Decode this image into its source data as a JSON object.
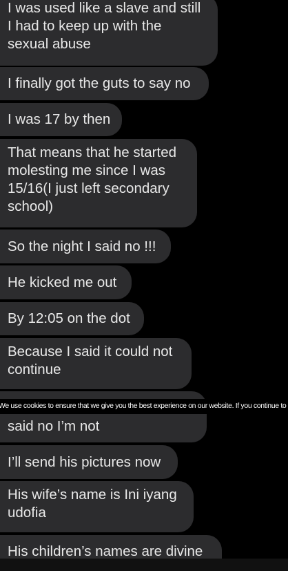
{
  "messages": [
    {
      "text": "I was used like a slave and still\nI had to keep up with the\nsexual abuse"
    },
    {
      "text": "I finally got the guts to say no"
    },
    {
      "text": "I was 17 by then"
    },
    {
      "text": "That means that he started\nmolesting me since I was\n15/16(I just left secondary\nschool)"
    },
    {
      "text": "So the night I said no !!!"
    },
    {
      "text": "He kicked me out"
    },
    {
      "text": "By 12:05 on the dot"
    },
    {
      "text": "Because I said it could not\ncontinue"
    },
    {
      "text": "said no I’m not"
    },
    {
      "text": "I’ll send his pictures now"
    },
    {
      "text": "His wife’s name is Ini iyang\nudofia"
    },
    {
      "text": "His children’s names are divine"
    }
  ],
  "cookie_notice": {
    "text": "We use cookies to ensure that we give you the best experience on our website. If you continue to use this site"
  },
  "colors": {
    "background": "#000000",
    "bubble": "#2c2c2e",
    "bubble_text": "#e8e8e8",
    "cookie_text": "#ffffff"
  }
}
